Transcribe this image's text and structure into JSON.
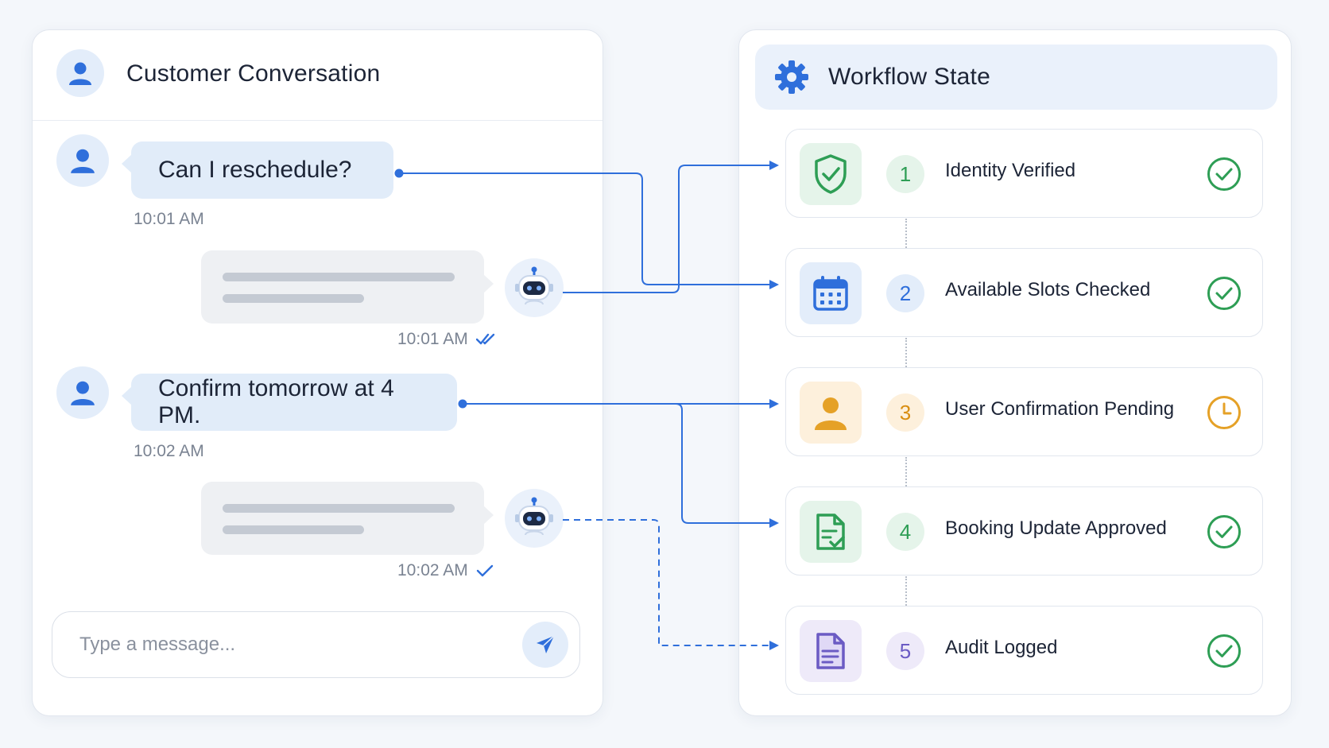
{
  "conversation": {
    "title": "Customer Conversation",
    "messages": [
      {
        "sender": "user",
        "text": "Can I reschedule?",
        "time": "10:01 AM"
      },
      {
        "sender": "bot",
        "time": "10:01 AM",
        "receipt": "read"
      },
      {
        "sender": "user",
        "text": "Confirm tomorrow at 4 PM.",
        "time": "10:02 AM"
      },
      {
        "sender": "bot",
        "time": "10:02 AM",
        "receipt": "sent"
      }
    ],
    "input": {
      "placeholder": "Type a message...",
      "value": ""
    }
  },
  "workflow": {
    "title": "Workflow State",
    "steps": [
      {
        "number": "1",
        "label": "Identity Verified",
        "icon": "shield-check-icon",
        "status": "complete"
      },
      {
        "number": "2",
        "label": "Available Slots Checked",
        "icon": "calendar-icon",
        "status": "complete"
      },
      {
        "number": "3",
        "label": "User Confirmation Pending",
        "icon": "user-icon",
        "status": "pending"
      },
      {
        "number": "4",
        "label": "Booking Update Approved",
        "icon": "document-check-icon",
        "status": "complete"
      },
      {
        "number": "5",
        "label": "Audit Logged",
        "icon": "document-icon",
        "status": "complete"
      }
    ]
  },
  "colors": {
    "accent": "#2f6fdb",
    "complete": "#2e9e55",
    "pending": "#e5a127",
    "audit": "#6b5bc4",
    "user_bubble": "#e1ecf9",
    "bot_bubble": "#eef0f3"
  }
}
